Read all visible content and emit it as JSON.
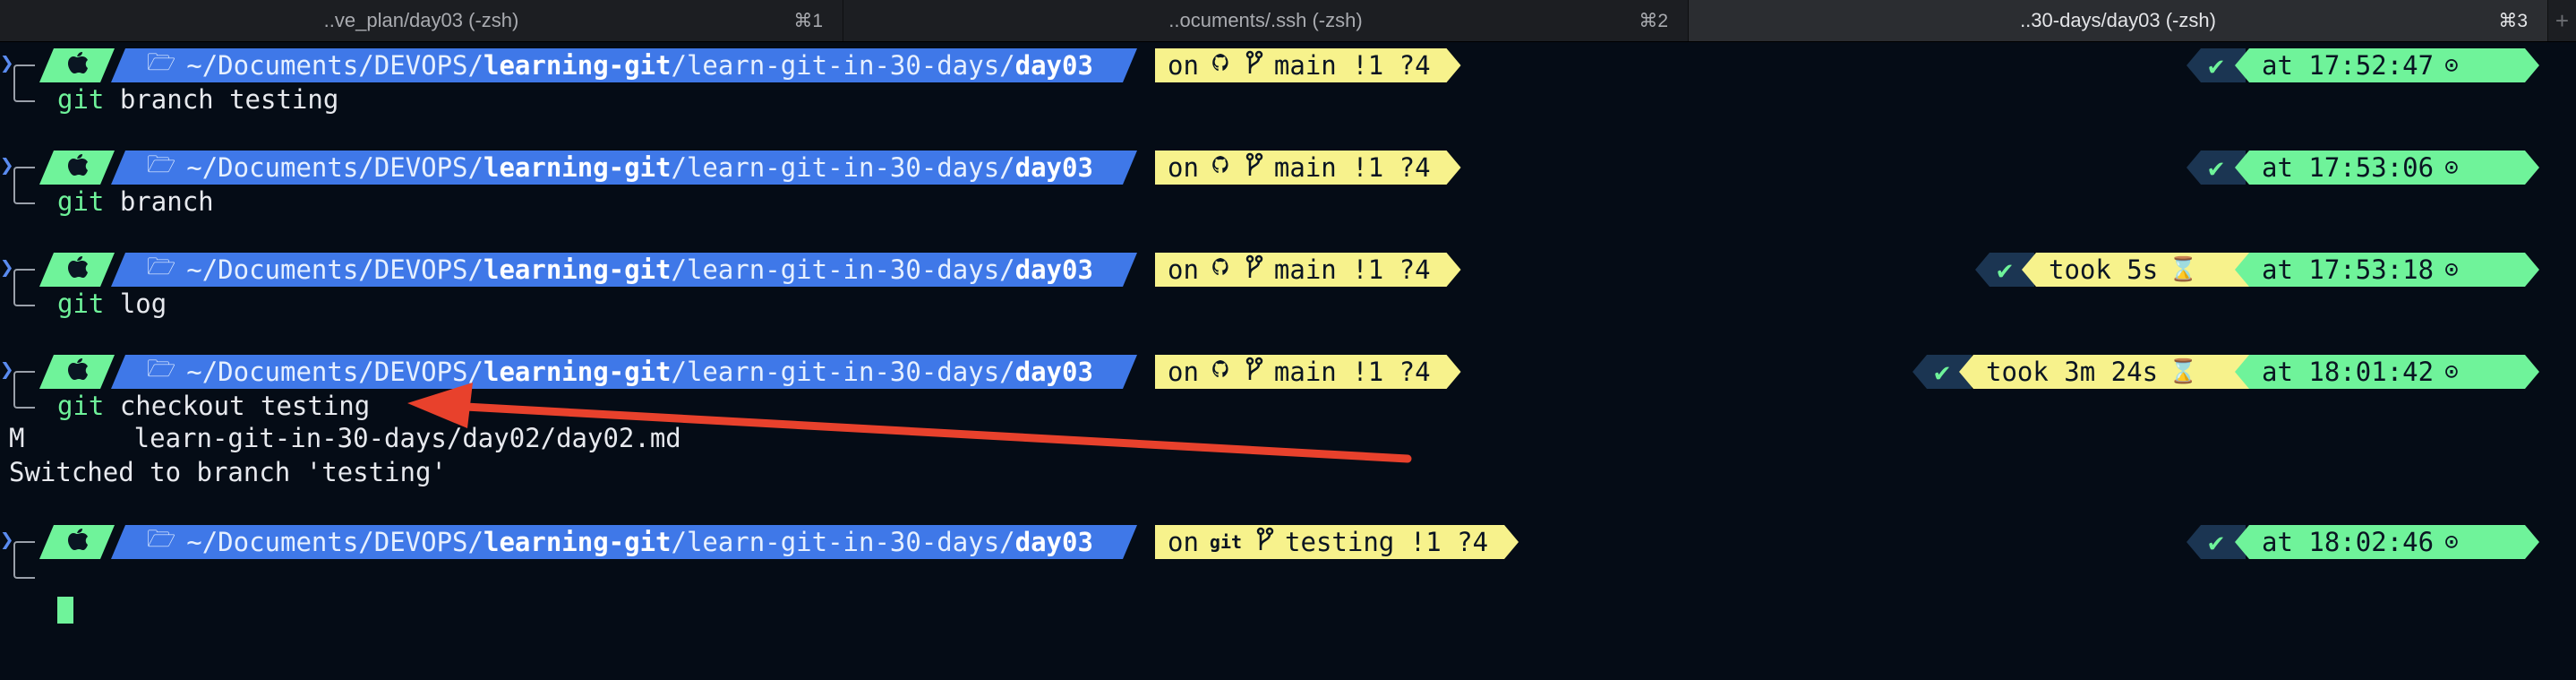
{
  "tabs": [
    {
      "title": "..ve_plan/day03 (-zsh)",
      "shortcut": "⌘1"
    },
    {
      "title": "..ocuments/.ssh (-zsh)",
      "shortcut": "⌘2"
    },
    {
      "title": "..30-days/day03 (-zsh)",
      "shortcut": "⌘3",
      "active": true
    }
  ],
  "prompt": {
    "caret": "❯",
    "apple_icon": "apple-icon",
    "folder_icon": "folder-icon",
    "path_prefix": "~/Documents/DEVOPS/",
    "path_bold1": "learning-git",
    "path_mid": "/learn-git-in-30-days/",
    "path_bold2": "day03",
    "on_label": "on",
    "check": "✔",
    "at_label": "at",
    "clock_icon": "⊙",
    "hourglass_icon": "⌛",
    "branch_icon": "branch-icon"
  },
  "entries": [
    {
      "branch": "main",
      "status": "!1 ?4",
      "took": "",
      "time": "17:52:47",
      "cmd_git": "git",
      "cmd_args": " branch testing"
    },
    {
      "branch": "main",
      "status": "!1 ?4",
      "took": "",
      "time": "17:53:06",
      "cmd_git": "git",
      "cmd_args": " branch"
    },
    {
      "branch": "main",
      "status": "!1 ?4",
      "took": "took 5s",
      "time": "17:53:18",
      "cmd_git": "git",
      "cmd_args": " log"
    },
    {
      "branch": "main",
      "status": "!1 ?4",
      "took": "took 3m 24s",
      "time": "18:01:42",
      "cmd_git": "git",
      "cmd_args": " checkout testing"
    },
    {
      "branch": "testing",
      "status": "!1 ?4",
      "took": "",
      "time": "18:02:46",
      "cmd_git": "",
      "cmd_args": ""
    }
  ],
  "output": [
    "M       learn-git-in-30-days/day02/day02.md",
    "Switched to branch 'testing'"
  ],
  "vcs_labels": {
    "github": "github-icon",
    "git": "git"
  },
  "colors": {
    "background": "#050c16",
    "green": "#6ff39a",
    "blue": "#3f78e8",
    "yellow": "#f7f28c",
    "dark_blue": "#1b3552",
    "arrow": "#e8412c"
  }
}
